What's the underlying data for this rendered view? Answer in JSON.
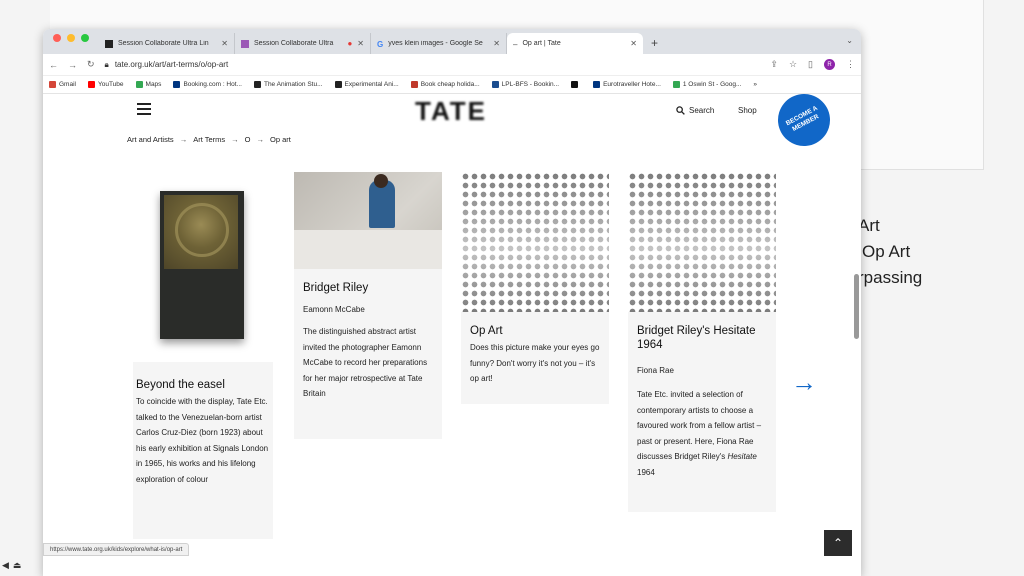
{
  "background_slide": {
    "lines": [
      "Art",
      "Op Art",
      "rpassing"
    ]
  },
  "browser": {
    "tabs": [
      {
        "label": "Session Collaborate Ultra Lin",
        "icon": "blackboard-icon",
        "color": "#222222"
      },
      {
        "label": "Session Collaborate Ultra",
        "icon": "collaborate-icon",
        "color": "#9b59b6"
      },
      {
        "label": "yves klein images - Google Se",
        "icon": "google-icon",
        "color": "#4285f4"
      },
      {
        "label": "Op art | Tate",
        "icon": "tate-icon",
        "color": "#444444",
        "active": true
      }
    ],
    "url": "tate.org.uk/art/art-terms/o/op-art",
    "profile_initial": "R",
    "bookmarks": [
      {
        "label": "Gmail",
        "color": "#d44638"
      },
      {
        "label": "YouTube",
        "color": "#ff0000"
      },
      {
        "label": "Maps",
        "color": "#34a853"
      },
      {
        "label": "Booking.com : Hot...",
        "color": "#003580"
      },
      {
        "label": "The Animation Stu...",
        "color": "#222222"
      },
      {
        "label": "Experimental Ani...",
        "color": "#222222"
      },
      {
        "label": "Book cheap holida...",
        "color": "#c0392b"
      },
      {
        "label": "LPL-BFS - Bookin...",
        "color": "#1a4d8f"
      },
      {
        "label": "",
        "color": "#111111"
      },
      {
        "label": "Eurotraveller Hote...",
        "color": "#003580"
      },
      {
        "label": "1 Oswin St - Goog...",
        "color": "#34a853"
      }
    ],
    "status_url": "https://www.tate.org.uk/kids/explore/what-is/op-art"
  },
  "site": {
    "logo": "TATE",
    "search_label": "Search",
    "shop_label": "Shop",
    "member_badge": "BECOME A MEMBER",
    "accent": "#1167c8"
  },
  "breadcrumb": [
    "Art and Artists",
    "Art Terms",
    "O",
    "Op art"
  ],
  "cards": [
    {
      "title": "Beyond the easel",
      "author": "",
      "description": "To coincide with the display, Tate Etc. talked to the Venezuelan-born artist Carlos Cruz-Diez (born 1923) about his early exhibition at Signals London in 1965, his works and his lifelong exploration of colour"
    },
    {
      "title": "Bridget Riley",
      "author": "Eamonn McCabe",
      "description": "The distinguished abstract artist invited the photographer Eamonn McCabe to record her preparations for her major retrospective at Tate Britain"
    },
    {
      "title": "Op Art",
      "author": "",
      "description": "Does this picture make your eyes go funny? Don't worry it's not you – it's op art!"
    },
    {
      "title": "Bridget Riley's Hesitate 1964",
      "author": "Fiona Rae",
      "description_pre": "Tate Etc. invited a selection of contemporary artists to choose a favoured work from a fellow artist – past or present. Here, Fiona Rae discusses Bridget Riley's ",
      "description_em": "Hesitate",
      "description_post": " 1964"
    }
  ]
}
